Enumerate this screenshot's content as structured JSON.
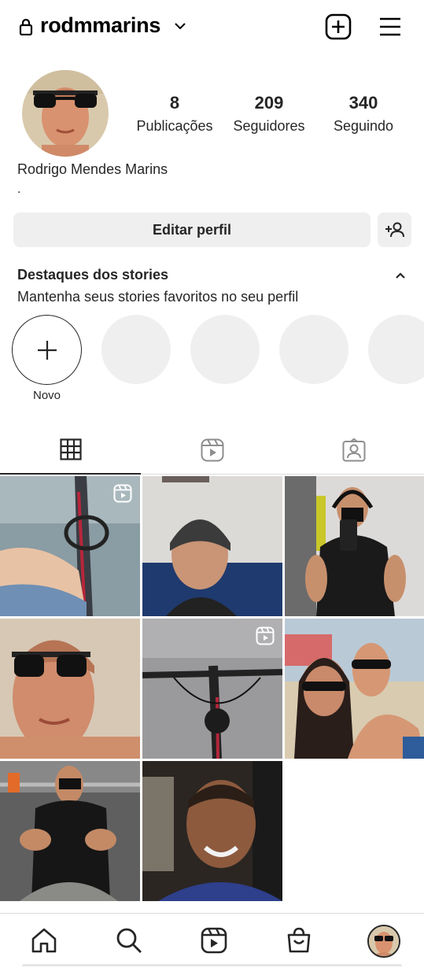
{
  "header": {
    "username": "rodmmarins",
    "icons": [
      "lock-icon",
      "chevron-down-icon",
      "new-post-icon",
      "menu-icon"
    ]
  },
  "profile": {
    "stats": [
      {
        "value": "8",
        "label": "Publicações"
      },
      {
        "value": "209",
        "label": "Seguidores"
      },
      {
        "value": "340",
        "label": "Seguindo"
      }
    ],
    "full_name": "Rodrigo Mendes Marins",
    "bio": ".",
    "edit_button": "Editar perfil"
  },
  "highlights": {
    "title": "Destaques dos stories",
    "subtitle": "Mantenha seus stories favoritos no seu perfil",
    "new_label": "Novo",
    "placeholder_count": 4
  },
  "tabs": [
    {
      "name": "grid",
      "icon": "grid-icon",
      "active": true
    },
    {
      "name": "reels",
      "icon": "reels-icon",
      "active": false
    },
    {
      "name": "tagged",
      "icon": "tagged-icon",
      "active": false
    }
  ],
  "posts": [
    {
      "subject": "bike handlebar and knee",
      "is_reel": true
    },
    {
      "subject": "selfie with beanie",
      "is_reel": false
    },
    {
      "subject": "gym mirror selfie with headphones",
      "is_reel": false
    },
    {
      "subject": "beach selfie with sunglasses",
      "is_reel": false
    },
    {
      "subject": "bike handlebar on road",
      "is_reel": true
    },
    {
      "subject": "beach selfie couple",
      "is_reel": false
    },
    {
      "subject": "gym mirror selfie seated",
      "is_reel": false
    },
    {
      "subject": "night selfie smiling",
      "is_reel": false
    }
  ],
  "bottom_nav": [
    "home-icon",
    "search-icon",
    "reels-icon",
    "shop-icon",
    "profile-avatar"
  ],
  "colors": {
    "text": "#262626",
    "button_bg": "#efefef",
    "divider": "#dbdbdb"
  }
}
